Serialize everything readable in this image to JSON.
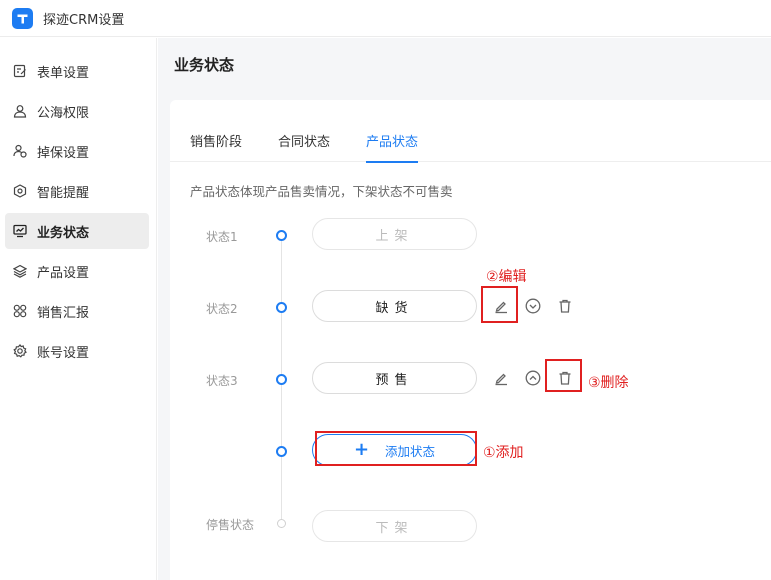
{
  "app": {
    "title": "探迹CRM设置"
  },
  "sidebar": {
    "items": [
      {
        "label": "表单设置",
        "icon": "form-edit-icon"
      },
      {
        "label": "公海权限",
        "icon": "user-icon"
      },
      {
        "label": "掉保设置",
        "icon": "user-refresh-icon"
      },
      {
        "label": "智能提醒",
        "icon": "smart-reminder-icon"
      },
      {
        "label": "业务状态",
        "icon": "monitor-chart-icon",
        "active": true
      },
      {
        "label": "产品设置",
        "icon": "layers-icon"
      },
      {
        "label": "销售汇报",
        "icon": "grid-icon"
      },
      {
        "label": "账号设置",
        "icon": "gear-icon"
      }
    ]
  },
  "main": {
    "page_title": "业务状态",
    "tabs": [
      {
        "label": "销售阶段"
      },
      {
        "label": "合同状态"
      },
      {
        "label": "产品状态",
        "active": true
      }
    ],
    "description": "产品状态体现产品售卖情况，下架状态不可售卖",
    "statuses": [
      {
        "label": "状态1",
        "value": "上架",
        "editable": false
      },
      {
        "label": "状态2",
        "value": "缺货",
        "editable": true
      },
      {
        "label": "状态3",
        "value": "预售",
        "editable": true
      }
    ],
    "add_button": "添加状态",
    "final_status": {
      "label": "停售状态",
      "value": "下架"
    }
  },
  "annotations": {
    "edit": "②编辑",
    "delete": "③删除",
    "add": "①添加"
  },
  "colors": {
    "accent": "#1d7cf2",
    "annotation": "#e02020"
  }
}
